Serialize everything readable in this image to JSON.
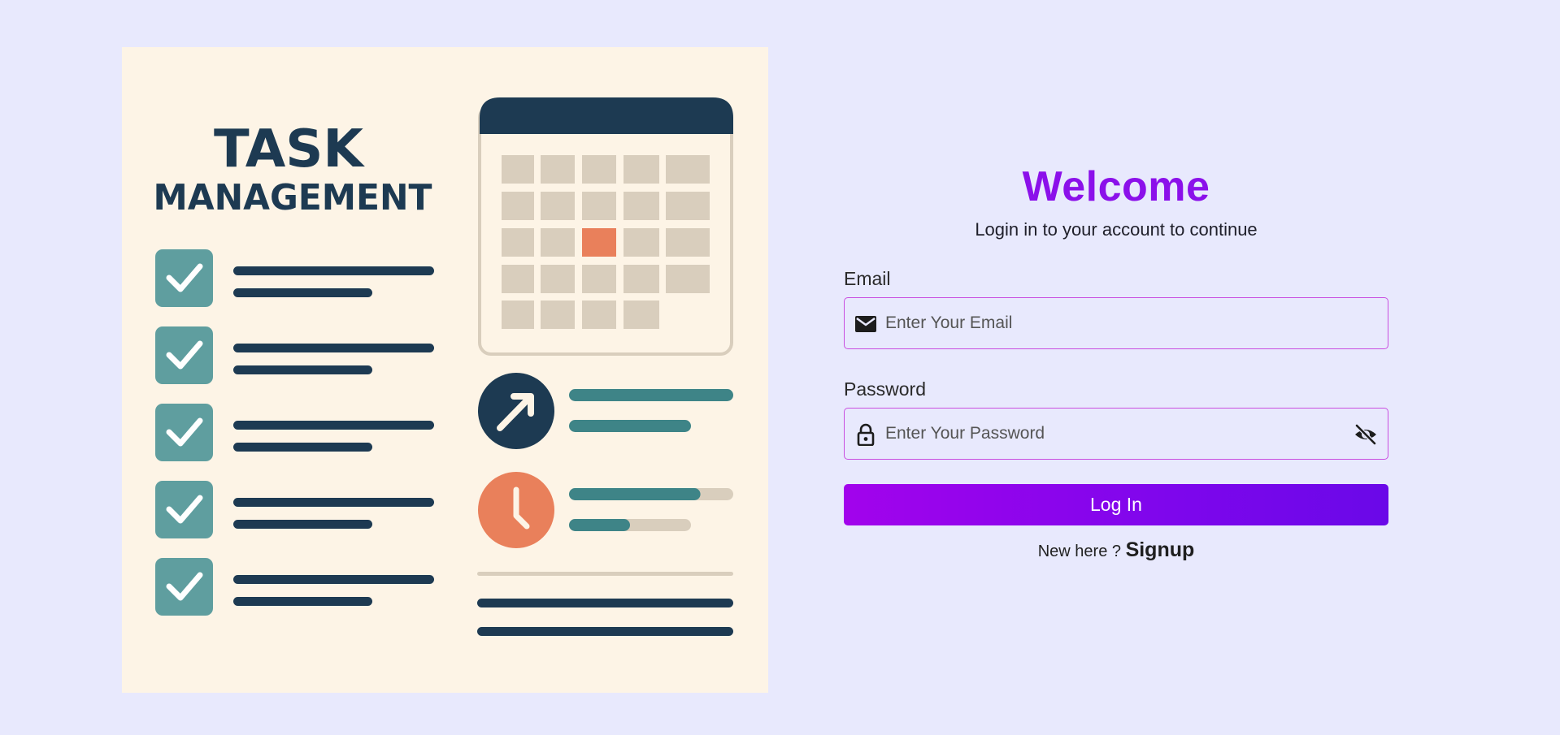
{
  "illustration": {
    "title_line1": "TASK",
    "title_line2": "MANAGEMENT",
    "icons": [
      "checkbox-checked-icon",
      "calendar-icon",
      "arrow-up-right-icon",
      "clock-icon"
    ],
    "progress": [
      0.8,
      0.5
    ],
    "colors": {
      "navy": "#1d3a52",
      "teal": "#5f9e9f",
      "orange": "#e9805b",
      "cream": "#fdf4e6",
      "calendar_cell": "#d9cebd"
    }
  },
  "login": {
    "title": "Welcome",
    "subtitle": "Login in to your account to continue",
    "email": {
      "label": "Email",
      "placeholder": "Enter Your Email",
      "value": "",
      "icon": "envelope-icon"
    },
    "password": {
      "label": "Password",
      "placeholder": "Enter Your Password",
      "value": "",
      "icon": "lock-icon",
      "toggle_icon": "eye-off-icon"
    },
    "submit_label": "Log In",
    "signup_prompt": "New here ?",
    "signup_link": "Signup",
    "colors": {
      "accent": "#8b10ea",
      "button_start": "#a203ec",
      "button_end": "#6a08e8",
      "input_border": "#c94ee0",
      "background": "#e8e9fd"
    }
  }
}
